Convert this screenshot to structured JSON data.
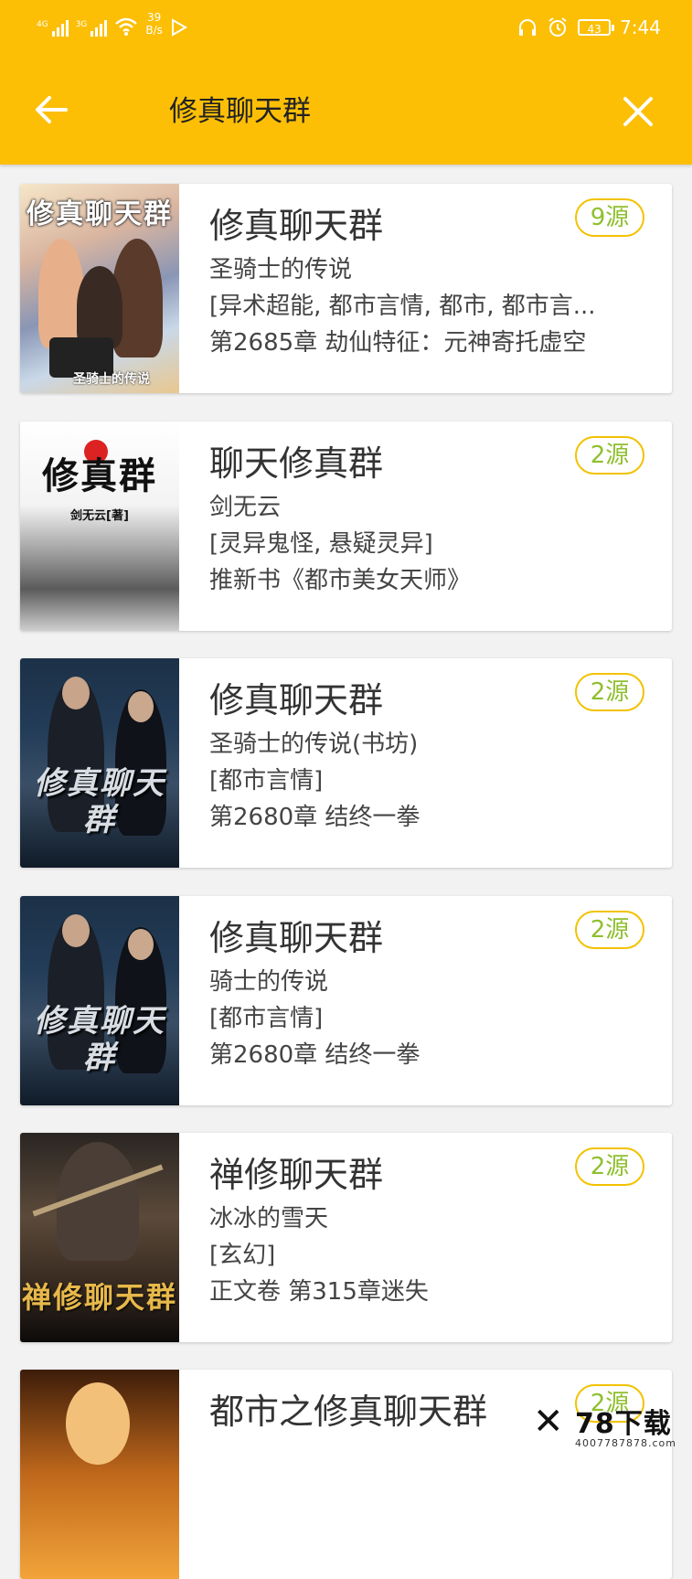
{
  "status_bar": {
    "signal1_label": "4G",
    "signal2_label": "3G",
    "net_speed_value": "39",
    "net_speed_unit": "B/s",
    "battery": "43",
    "time": "7:44"
  },
  "app_bar": {
    "title": "修真聊天群"
  },
  "books": [
    {
      "cover_text": "修真聊天群",
      "cover_author": "圣骑士的传说",
      "title": "修真聊天群",
      "author": "圣骑士的传说",
      "tags": "[异术超能, 都市言情, 都市, 都市言...",
      "latest": "第2685章 劫仙特征：元神寄托虚空",
      "sources": "9源"
    },
    {
      "cover_text": "修真群",
      "cover_author": "剑无云[著]",
      "title": "聊天修真群",
      "author": "剑无云",
      "tags": "[灵异鬼怪, 悬疑灵异]",
      "latest": "推新书《都市美女天师》",
      "sources": "2源"
    },
    {
      "cover_text": "修真聊天群",
      "title": "修真聊天群",
      "author": "圣骑士的传说(书坊)",
      "tags": "[都市言情]",
      "latest": "第2680章 结终一拳",
      "sources": "2源"
    },
    {
      "cover_text": "修真聊天群",
      "title": "修真聊天群",
      "author": "骑士的传说",
      "tags": "[都市言情]",
      "latest": "第2680章 结终一拳",
      "sources": "2源"
    },
    {
      "cover_text": "禅修聊天群",
      "title": "禅修聊天群",
      "author": "冰冰的雪天",
      "tags": "[玄幻]",
      "latest": "正文卷 第315章迷失",
      "sources": "2源"
    },
    {
      "title": "都市之修真聊天群",
      "sources": "2源"
    }
  ],
  "watermark": {
    "brand": "78下载",
    "url": "4007787878.com"
  },
  "colors": {
    "accent": "#fcbf06",
    "badge_border": "#f2c200",
    "badge_text": "#8fbf2e"
  }
}
